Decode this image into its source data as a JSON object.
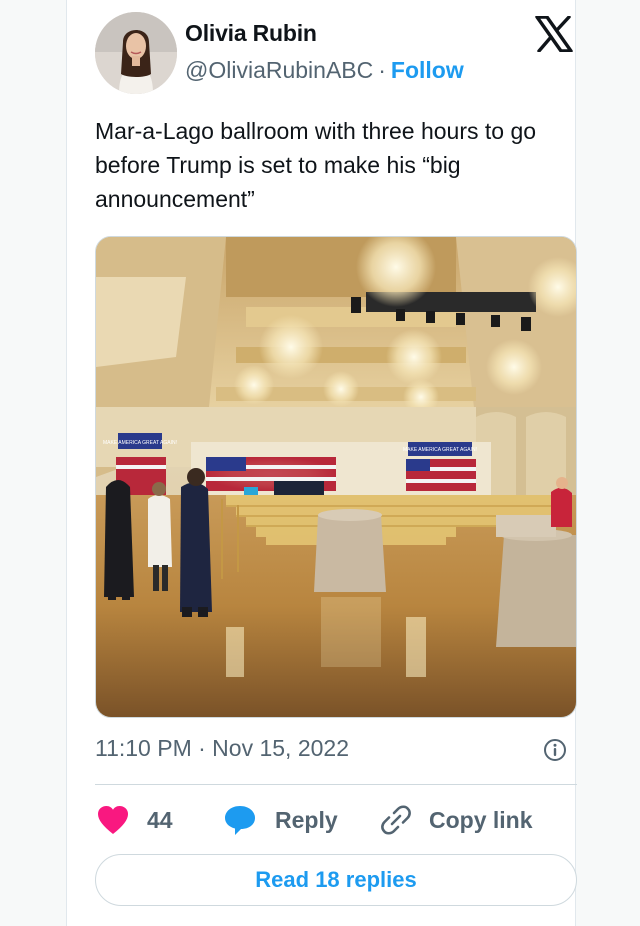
{
  "author": {
    "name": "Olivia Rubin",
    "handle": "@OliviaRubinABC",
    "separator": "·",
    "follow_label": "Follow"
  },
  "tweet": {
    "text": "Mar-a-Lago ballroom with three hours to go before Trump is set to make his “big announcement”",
    "timestamp": "11:10 PM · Nov 15, 2022"
  },
  "banners": {
    "left": "MAKE AMERICA GREAT AGAIN!",
    "right": "MAKE AMERICA GREAT AGAIN!"
  },
  "actions": {
    "like_count": "44",
    "reply_label": "Reply",
    "copy_label": "Copy link"
  },
  "read_replies_label": "Read 18 replies",
  "colors": {
    "accent": "#1d9bf0",
    "like": "#f91880",
    "secondary_text": "#536471"
  },
  "icons": {
    "brand": "x-logo-icon",
    "info": "info-icon",
    "like": "heart-icon",
    "reply": "speech-bubble-icon",
    "copy": "link-icon"
  }
}
